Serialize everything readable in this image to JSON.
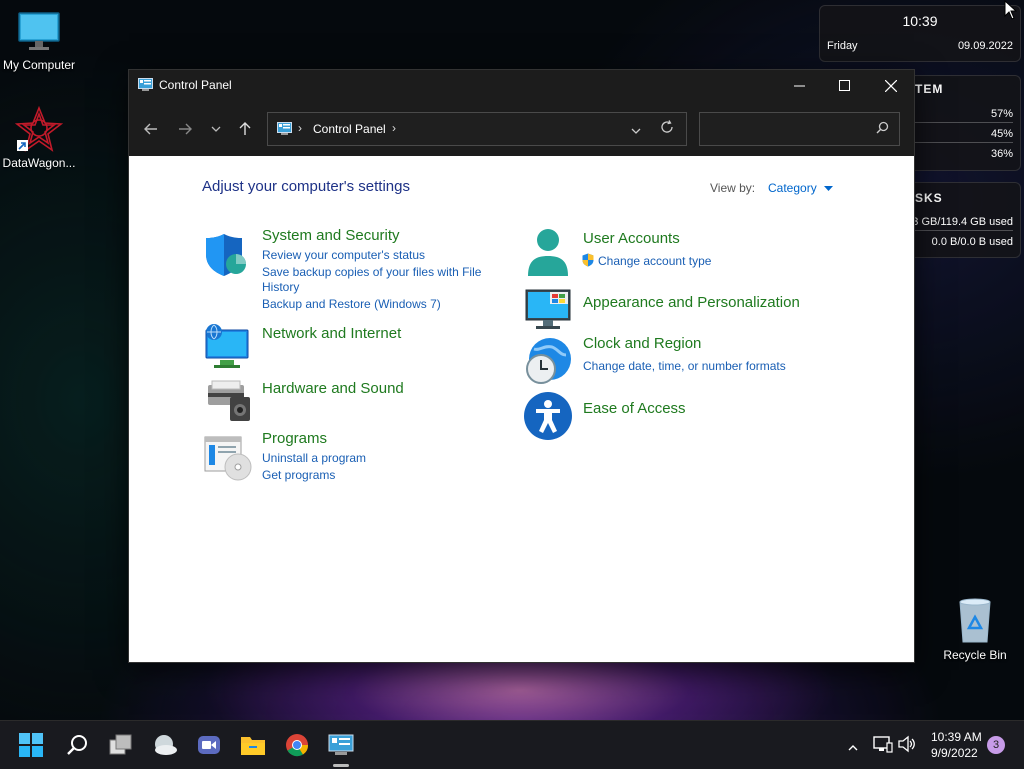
{
  "desktop": {
    "icons": [
      {
        "label": "My Computer"
      },
      {
        "label": "DataWagon..."
      },
      {
        "label": "Recycle Bin"
      }
    ]
  },
  "widgets": {
    "clock": {
      "time": "10:39",
      "day": "Friday",
      "date": "09.09.2022"
    },
    "system": {
      "header": "TEM",
      "rows": [
        "57%",
        "45%",
        "36%"
      ]
    },
    "disks": {
      "header": "SKS",
      "rows": [
        "3 GB/119.4 GB used",
        "0.0 B/0.0 B used"
      ]
    }
  },
  "window": {
    "title": "Control Panel",
    "address_crumb": "Control Panel",
    "search_placeholder": "",
    "heading": "Adjust your computer's settings",
    "view_by_label": "View by:",
    "view_by_value": "Category",
    "categories": [
      {
        "title": "System and Security",
        "links": [
          "Review your computer's status",
          "Save backup copies of your files with File",
          "History",
          "Backup and Restore (Windows 7)"
        ]
      },
      {
        "title": "Network and Internet",
        "links": []
      },
      {
        "title": "Hardware and Sound",
        "links": []
      },
      {
        "title": "Programs",
        "links": [
          "Uninstall a program",
          "Get programs"
        ]
      },
      {
        "title": "User Accounts",
        "links": [
          "Change account type"
        ]
      },
      {
        "title": "Appearance and Personalization",
        "links": []
      },
      {
        "title": "Clock and Region",
        "links": [
          "Change date, time, or number formats"
        ]
      },
      {
        "title": "Ease of Access",
        "links": []
      }
    ]
  },
  "taskbar": {
    "time": "10:39 AM",
    "date": "9/9/2022",
    "notification_count": "3"
  },
  "colors": {
    "link": "#1a5fb4",
    "category_title": "#1f7a1f",
    "heading": "#1e3287",
    "titlebar": "#1c1c1c",
    "taskbar": "#191a1f"
  }
}
